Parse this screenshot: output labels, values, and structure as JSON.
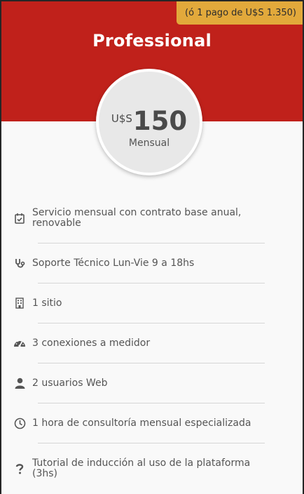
{
  "plan": {
    "badge": "(ó 1 pago de U$S 1.350)",
    "title": "Professional",
    "currency": "U$S",
    "price": "150",
    "period": "Mensual"
  },
  "features": [
    {
      "icon": "calendar-check-icon",
      "text": "Servicio mensual con contrato base anual, renovable"
    },
    {
      "icon": "stethoscope-icon",
      "text": "Soporte Técnico Lun-Vie 9 a 18hs"
    },
    {
      "icon": "building-icon",
      "text": "1 sitio"
    },
    {
      "icon": "gauge-icon",
      "text": "3 conexiones a medidor"
    },
    {
      "icon": "user-icon",
      "text": "2 usuarios Web"
    },
    {
      "icon": "clock-icon",
      "text": "1 hora de consultoría mensual especializada"
    },
    {
      "icon": "question-icon",
      "text": "Tutorial de inducción al uso de la plataforma (3hs)"
    }
  ],
  "colors": {
    "header": "#c0211b",
    "badge": "#e2a93b",
    "card": "#f9f9f9",
    "text": "#555555"
  }
}
